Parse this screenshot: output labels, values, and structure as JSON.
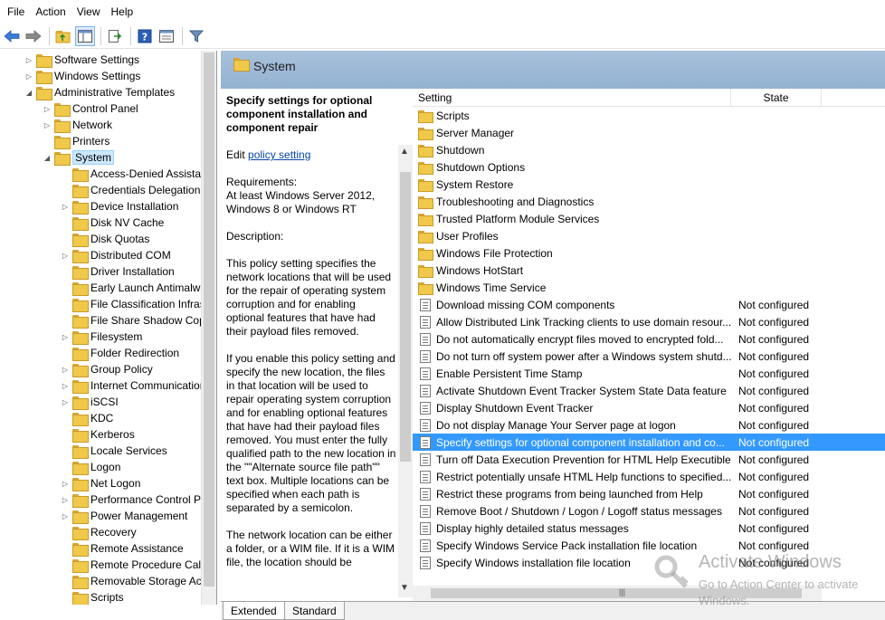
{
  "menu": [
    "File",
    "Action",
    "View",
    "Help"
  ],
  "toolbar": {
    "icons": [
      "back-arrow-icon",
      "forward-arrow-icon",
      "up-folder-icon",
      "show-hide-tree-icon",
      "export-list-icon",
      "help-icon",
      "properties-icon",
      "filter-icon"
    ]
  },
  "tree": {
    "items": [
      {
        "label": "Software Settings",
        "level": 1,
        "expander": "collapsed"
      },
      {
        "label": "Windows Settings",
        "level": 1,
        "expander": "collapsed"
      },
      {
        "label": "Administrative Templates",
        "level": 1,
        "expander": "expanded"
      },
      {
        "label": "Control Panel",
        "level": 2,
        "expander": "collapsed"
      },
      {
        "label": "Network",
        "level": 2,
        "expander": "collapsed"
      },
      {
        "label": "Printers",
        "level": 2,
        "expander": "none"
      },
      {
        "label": "System",
        "level": 2,
        "expander": "expanded",
        "selected": true
      },
      {
        "label": "Access-Denied Assistance",
        "level": 3,
        "expander": "none"
      },
      {
        "label": "Credentials Delegation",
        "level": 3,
        "expander": "none"
      },
      {
        "label": "Device Installation",
        "level": 3,
        "expander": "collapsed"
      },
      {
        "label": "Disk NV Cache",
        "level": 3,
        "expander": "none"
      },
      {
        "label": "Disk Quotas",
        "level": 3,
        "expander": "none"
      },
      {
        "label": "Distributed COM",
        "level": 3,
        "expander": "collapsed"
      },
      {
        "label": "Driver Installation",
        "level": 3,
        "expander": "none"
      },
      {
        "label": "Early Launch Antimalware",
        "level": 3,
        "expander": "none"
      },
      {
        "label": "File Classification Infrastructure",
        "level": 3,
        "expander": "none"
      },
      {
        "label": "File Share Shadow Copy",
        "level": 3,
        "expander": "none"
      },
      {
        "label": "Filesystem",
        "level": 3,
        "expander": "collapsed"
      },
      {
        "label": "Folder Redirection",
        "level": 3,
        "expander": "none"
      },
      {
        "label": "Group Policy",
        "level": 3,
        "expander": "collapsed"
      },
      {
        "label": "Internet Communication",
        "level": 3,
        "expander": "collapsed"
      },
      {
        "label": "iSCSI",
        "level": 3,
        "expander": "collapsed"
      },
      {
        "label": "KDC",
        "level": 3,
        "expander": "none"
      },
      {
        "label": "Kerberos",
        "level": 3,
        "expander": "none"
      },
      {
        "label": "Locale Services",
        "level": 3,
        "expander": "none"
      },
      {
        "label": "Logon",
        "level": 3,
        "expander": "none"
      },
      {
        "label": "Net Logon",
        "level": 3,
        "expander": "collapsed"
      },
      {
        "label": "Performance Control Panel",
        "level": 3,
        "expander": "collapsed"
      },
      {
        "label": "Power Management",
        "level": 3,
        "expander": "collapsed"
      },
      {
        "label": "Recovery",
        "level": 3,
        "expander": "none"
      },
      {
        "label": "Remote Assistance",
        "level": 3,
        "expander": "none"
      },
      {
        "label": "Remote Procedure Call",
        "level": 3,
        "expander": "none"
      },
      {
        "label": "Removable Storage Access",
        "level": 3,
        "expander": "none"
      },
      {
        "label": "Scripts",
        "level": 3,
        "expander": "none"
      }
    ]
  },
  "header": {
    "title": "System"
  },
  "description": {
    "title": "Specify settings for optional component installation and component repair",
    "edit_prefix": "Edit ",
    "edit_link": "policy setting",
    "requirements_label": "Requirements:",
    "requirements": "At least Windows Server 2012, Windows 8 or Windows RT",
    "description_label": "Description:",
    "para1": "This policy setting specifies the network locations that will be used for the repair of operating system corruption and for enabling optional features that have had their payload files removed.",
    "para2": "If you enable this policy setting and specify the new location, the files in that location will be used to repair operating system corruption and for enabling optional features that have had their payload files removed. You must enter the fully qualified path to the new location in the \"\"Alternate source file path\"\" text box. Multiple locations can be specified when each path is separated by a semicolon.",
    "para3": "The network location can be either a folder, or a WIM file. If it is a WIM file, the location should be"
  },
  "list": {
    "columns": {
      "setting": "Setting",
      "state": "State"
    },
    "rows": [
      {
        "name": "Scripts",
        "type": "folder",
        "state": ""
      },
      {
        "name": "Server Manager",
        "type": "folder",
        "state": ""
      },
      {
        "name": "Shutdown",
        "type": "folder",
        "state": ""
      },
      {
        "name": "Shutdown Options",
        "type": "folder",
        "state": ""
      },
      {
        "name": "System Restore",
        "type": "folder",
        "state": ""
      },
      {
        "name": "Troubleshooting and Diagnostics",
        "type": "folder",
        "state": ""
      },
      {
        "name": "Trusted Platform Module Services",
        "type": "folder",
        "state": ""
      },
      {
        "name": "User Profiles",
        "type": "folder",
        "state": ""
      },
      {
        "name": "Windows File Protection",
        "type": "folder",
        "state": ""
      },
      {
        "name": "Windows HotStart",
        "type": "folder",
        "state": ""
      },
      {
        "name": "Windows Time Service",
        "type": "folder",
        "state": ""
      },
      {
        "name": "Download missing COM components",
        "type": "policy",
        "state": "Not configured"
      },
      {
        "name": "Allow Distributed Link Tracking clients to use domain resour...",
        "type": "policy",
        "state": "Not configured"
      },
      {
        "name": "Do not automatically encrypt files moved to encrypted fold...",
        "type": "policy",
        "state": "Not configured"
      },
      {
        "name": "Do not turn off system power after a Windows system shutd...",
        "type": "policy",
        "state": "Not configured"
      },
      {
        "name": "Enable Persistent Time Stamp",
        "type": "policy",
        "state": "Not configured"
      },
      {
        "name": "Activate Shutdown Event Tracker System State Data feature",
        "type": "policy",
        "state": "Not configured"
      },
      {
        "name": "Display Shutdown Event Tracker",
        "type": "policy",
        "state": "Not configured"
      },
      {
        "name": "Do not display Manage Your Server page at logon",
        "type": "policy",
        "state": "Not configured"
      },
      {
        "name": "Specify settings for optional component installation and co...",
        "type": "policy",
        "state": "Not configured",
        "selected": true
      },
      {
        "name": "Turn off Data Execution Prevention for HTML Help Executible",
        "type": "policy",
        "state": "Not configured"
      },
      {
        "name": "Restrict potentially unsafe HTML Help functions to specified...",
        "type": "policy",
        "state": "Not configured"
      },
      {
        "name": "Restrict these programs from being launched from Help",
        "type": "policy",
        "state": "Not configured"
      },
      {
        "name": "Remove Boot / Shutdown / Logon / Logoff status messages",
        "type": "policy",
        "state": "Not configured"
      },
      {
        "name": "Display highly detailed status messages",
        "type": "policy",
        "state": "Not configured"
      },
      {
        "name": "Specify Windows Service Pack installation file location",
        "type": "policy",
        "state": "Not configured"
      },
      {
        "name": "Specify Windows installation file location",
        "type": "policy",
        "state": "Not configured"
      }
    ]
  },
  "tabs": {
    "extended": "Extended",
    "standard": "Standard"
  },
  "watermark": {
    "line1": "Activate Windows",
    "line2": "Go to Action Center to activate",
    "line3": "Windows."
  }
}
